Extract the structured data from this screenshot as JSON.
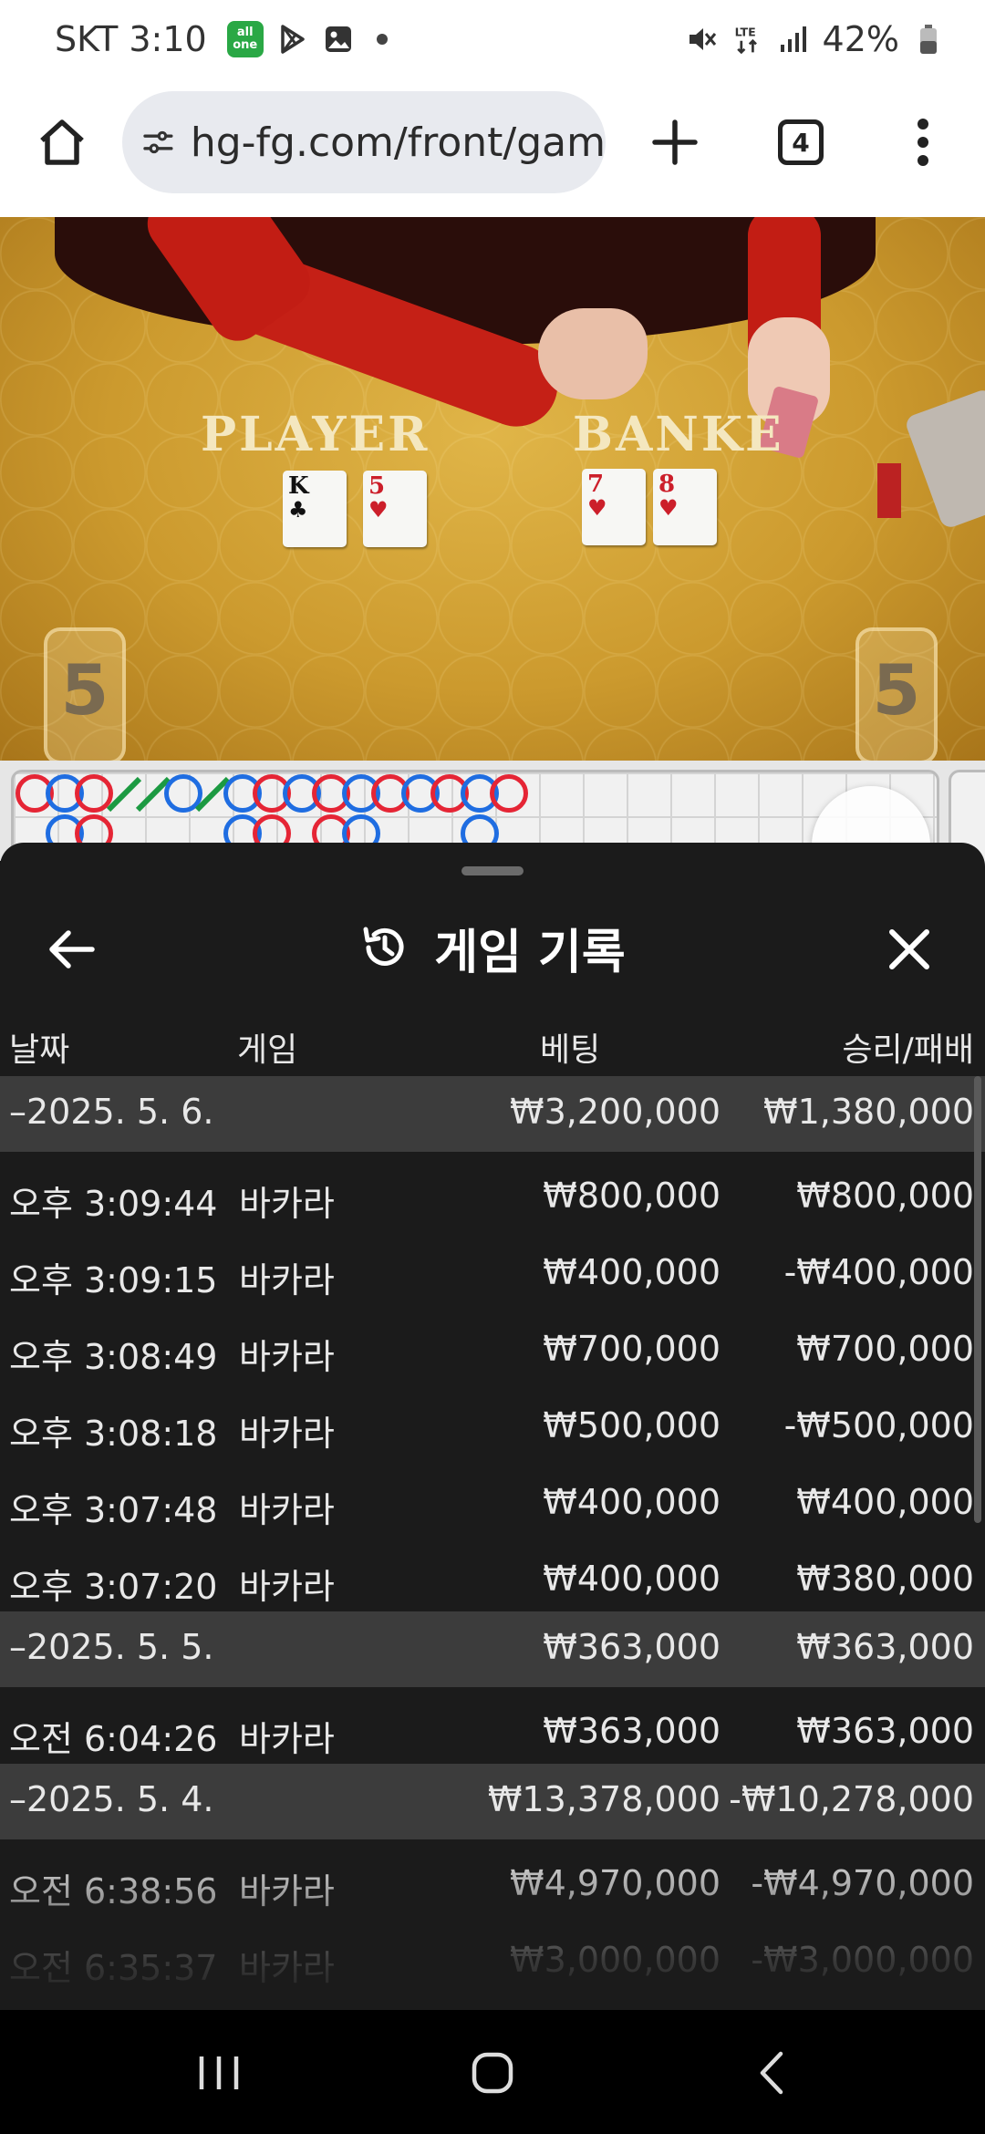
{
  "status_bar": {
    "time": "SKT 3:10",
    "app_badge_line1": "all",
    "app_badge_line2": "one",
    "battery": "42%",
    "network": "LTE"
  },
  "browser": {
    "url": "hg-fg.com/front/gam",
    "tab_count": "4"
  },
  "video": {
    "player_label": "PLAYER",
    "banker_label": "BANKE",
    "player_cards": [
      {
        "rank": "K",
        "suit": "♣",
        "color": "black"
      },
      {
        "rank": "5",
        "suit": "♥",
        "color": "red"
      }
    ],
    "banker_cards": [
      {
        "rank": "7",
        "suit": "♥",
        "color": "red"
      },
      {
        "rank": "8",
        "suit": "♥",
        "color": "red"
      }
    ],
    "player_score": "5",
    "banker_score": "5"
  },
  "history": {
    "title": "게임 기록",
    "columns": {
      "date": "날짜",
      "game": "게임",
      "bet": "베팅",
      "winloss": "승리/패배"
    },
    "rows": [
      {
        "type": "date",
        "date": "–2025. 5. 6.",
        "game": "",
        "bet": "₩3,200,000",
        "winloss": "₩1,380,000"
      },
      {
        "type": "item",
        "date": "오후 3:09:44",
        "game": "바카라",
        "bet": "₩800,000",
        "winloss": "₩800,000"
      },
      {
        "type": "item",
        "date": "오후 3:09:15",
        "game": "바카라",
        "bet": "₩400,000",
        "winloss": "-₩400,000"
      },
      {
        "type": "item",
        "date": "오후 3:08:49",
        "game": "바카라",
        "bet": "₩700,000",
        "winloss": "₩700,000"
      },
      {
        "type": "item",
        "date": "오후 3:08:18",
        "game": "바카라",
        "bet": "₩500,000",
        "winloss": "-₩500,000"
      },
      {
        "type": "item",
        "date": "오후 3:07:48",
        "game": "바카라",
        "bet": "₩400,000",
        "winloss": "₩400,000"
      },
      {
        "type": "item",
        "date": "오후 3:07:20",
        "game": "바카라",
        "bet": "₩400,000",
        "winloss": "₩380,000"
      },
      {
        "type": "date",
        "date": "–2025. 5. 5.",
        "game": "",
        "bet": "₩363,000",
        "winloss": "₩363,000"
      },
      {
        "type": "item",
        "date": "오전 6:04:26",
        "game": "바카라",
        "bet": "₩363,000",
        "winloss": "₩363,000"
      },
      {
        "type": "date",
        "date": "–2025. 5. 4.",
        "game": "",
        "bet": "₩13,378,000",
        "winloss": "-₩10,278,000"
      },
      {
        "type": "item",
        "date": "오전 6:38:56",
        "game": "바카라",
        "bet": "₩4,970,000",
        "winloss": "-₩4,970,000"
      },
      {
        "type": "item",
        "date": "오전 6:35:37",
        "game": "바카라",
        "bet": "₩3,000,000",
        "winloss": "-₩3,000,000"
      }
    ]
  },
  "roadmap": {
    "top_row": [
      "B",
      "P",
      "B",
      "T",
      "T",
      "P",
      "T",
      "P",
      "B",
      "P",
      "B",
      "P",
      "B",
      "P",
      "B",
      "P",
      "B"
    ],
    "second_row": [
      "",
      "P",
      "B",
      "",
      "",
      "",
      "",
      "P",
      "B",
      "",
      "B",
      "P",
      "",
      "",
      "",
      "P",
      ""
    ]
  },
  "colors": {
    "banker": "#e52535",
    "player": "#1f6de1",
    "tie": "#1c9a42",
    "sheet_bg": "#1b1b1b",
    "date_row_bg": "#3c3c3c"
  }
}
